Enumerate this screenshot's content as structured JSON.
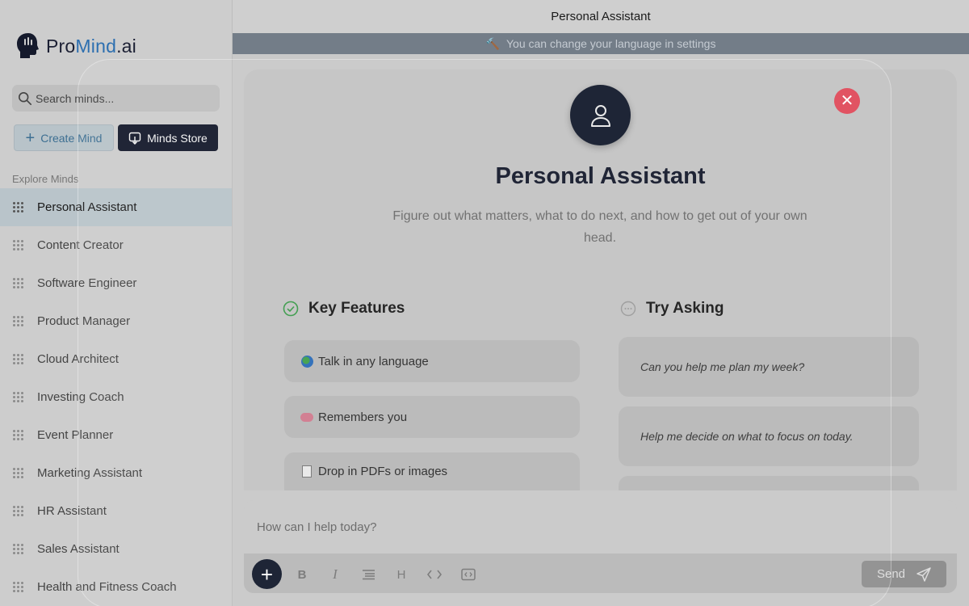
{
  "brand": {
    "pro": "Pro",
    "mind": "Mind",
    "ai": ".ai"
  },
  "sidebar": {
    "search_placeholder": "Search minds...",
    "create_label": "Create Mind",
    "store_label": "Minds Store",
    "section_label": "Explore Minds",
    "items": [
      {
        "label": "Personal Assistant",
        "active": true
      },
      {
        "label": "Content Creator"
      },
      {
        "label": "Software Engineer"
      },
      {
        "label": "Product Manager"
      },
      {
        "label": "Cloud Architect"
      },
      {
        "label": "Investing Coach"
      },
      {
        "label": "Event Planner"
      },
      {
        "label": "Marketing Assistant"
      },
      {
        "label": "HR Assistant"
      },
      {
        "label": "Sales Assistant"
      },
      {
        "label": "Health and Fitness Coach"
      }
    ]
  },
  "header": {
    "title": "Personal Assistant",
    "banner": "You can change your language in settings"
  },
  "mind": {
    "title": "Personal Assistant",
    "description": "Figure out what matters, what to do next, and how to get out of your own head.",
    "features_heading": "Key Features",
    "features": [
      {
        "icon": "globe-icon",
        "label": "Talk in any language"
      },
      {
        "icon": "brain-icon",
        "label": "Remembers you"
      },
      {
        "icon": "document-icon",
        "label": "Drop in PDFs or images"
      }
    ],
    "asking_heading": "Try Asking",
    "prompts": [
      "Can you help me plan my week?",
      "Help me decide on what to focus on today."
    ]
  },
  "composer": {
    "placeholder": "How can I help today?",
    "send_label": "Send",
    "tools": [
      "bold-icon",
      "italic-icon",
      "list-icon",
      "heading-icon",
      "code-icon",
      "code-block-icon"
    ]
  },
  "colors": {
    "brand_dark": "#151a2c",
    "brand_blue": "#2d6fb0",
    "active_item": "#b9c4ca",
    "close_red": "#e04a5a"
  }
}
